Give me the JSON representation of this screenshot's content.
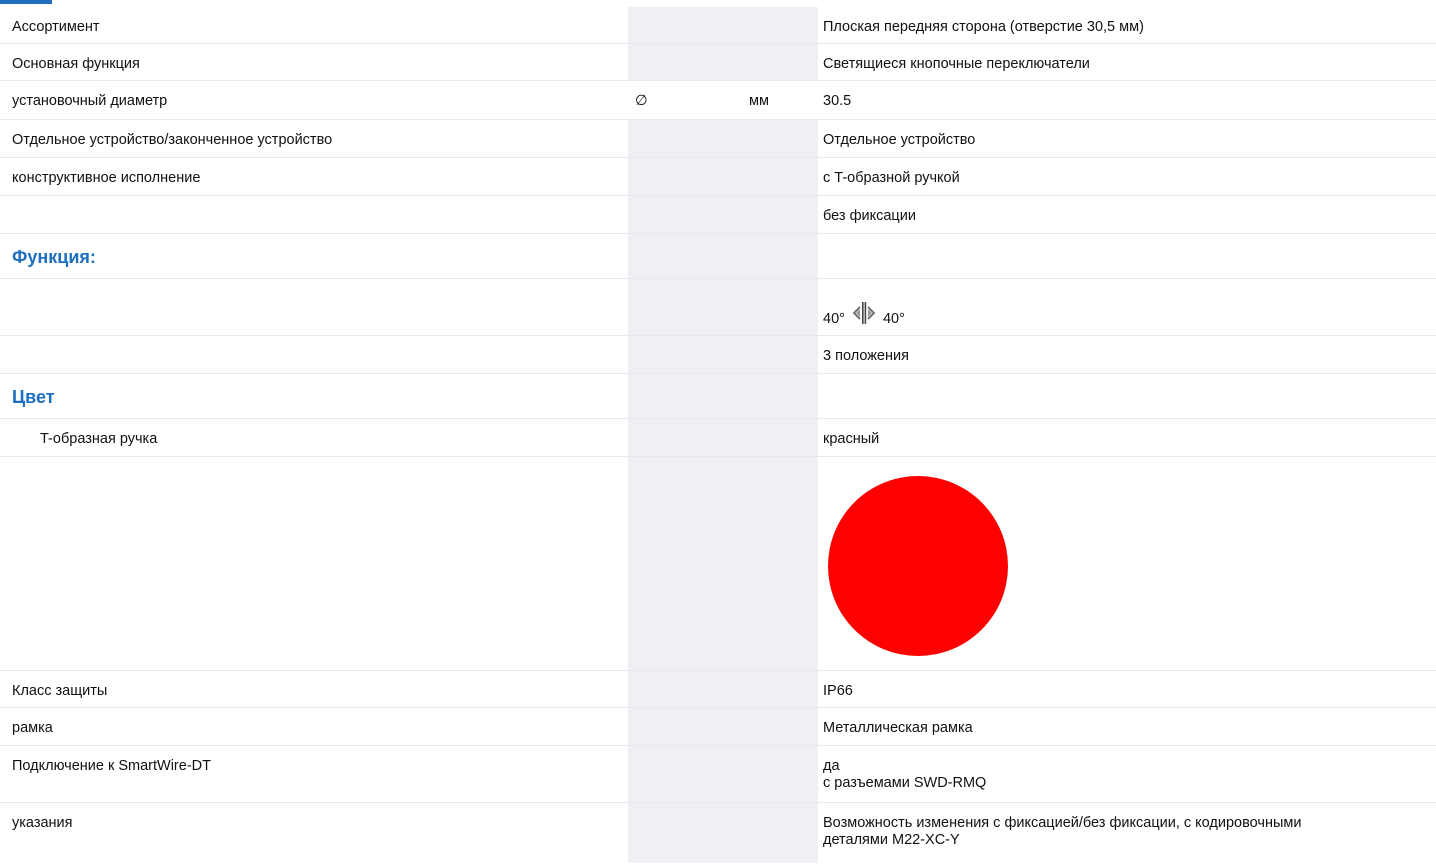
{
  "rows": [
    {
      "label": "Ассортимент",
      "value": "Плоская передняя сторона (отверстие 30,5 мм)"
    },
    {
      "label": "Основная функция",
      "value": "Светящиеся кнопочные переключатели"
    },
    {
      "label": "установочный диаметр",
      "symbol": "∅",
      "unit": "мм",
      "value": "30.5"
    },
    {
      "label": "Отдельное устройство/законченное устройство",
      "value": "Отдельное устройство"
    },
    {
      "label": "конструктивное исполнение",
      "value": "с T-образной ручкой"
    },
    {
      "label": "",
      "value": "без фиксации"
    }
  ],
  "function_section": {
    "heading": "Функция:",
    "angle_left": "40°",
    "angle_right": "40°",
    "icon": "rotary-switch-icon",
    "positions": "3 положения"
  },
  "color_section": {
    "heading": "Цвет",
    "handle_label": "T-образная ручка",
    "handle_value": "красный",
    "swatch_color": "#ff0000"
  },
  "rows_bottom": [
    {
      "label": "Класс защиты",
      "value": "IP66"
    },
    {
      "label": "рамка",
      "value": "Металлическая рамка"
    },
    {
      "label": "Подключение к SmartWire-DT",
      "value_line1": "да",
      "value_line2": "с разъемами SWD-RMQ"
    },
    {
      "label": "указания",
      "value_line1": "Возможность изменения с фиксацией/без фиксации, с кодировочными",
      "value_line2": "деталями M22-XC-Y"
    }
  ]
}
